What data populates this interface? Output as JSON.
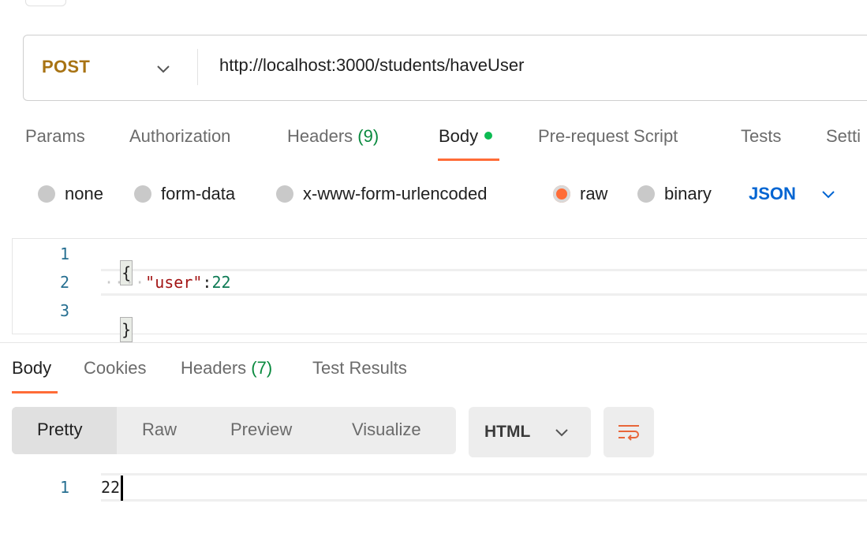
{
  "request": {
    "method": "POST",
    "url": "http://localhost:3000/students/haveUser",
    "tabs": [
      {
        "label": "Params",
        "count": ""
      },
      {
        "label": "Authorization",
        "count": ""
      },
      {
        "label": "Headers",
        "count": "(9)"
      },
      {
        "label": "Body",
        "count": ""
      },
      {
        "label": "Pre-request Script",
        "count": ""
      },
      {
        "label": "Tests",
        "count": ""
      },
      {
        "label": "Setti",
        "count": ""
      }
    ],
    "active_tab": "Body",
    "body_types": [
      "none",
      "form-data",
      "x-www-form-urlencoded",
      "raw",
      "binary"
    ],
    "selected_body_type": "raw",
    "body_format": "JSON",
    "editor": {
      "line_numbers": [
        "1",
        "2",
        "3"
      ],
      "open_brace": "{",
      "indent": "····",
      "key": "\"user\"",
      "colon": ":",
      "value": "22",
      "close_brace": "}"
    }
  },
  "response": {
    "tabs": [
      {
        "label": "Body",
        "count": ""
      },
      {
        "label": "Cookies",
        "count": ""
      },
      {
        "label": "Headers",
        "count": "(7)"
      },
      {
        "label": "Test Results",
        "count": ""
      }
    ],
    "active_tab": "Body",
    "view_modes": [
      "Pretty",
      "Raw",
      "Preview",
      "Visualize"
    ],
    "active_view": "Pretty",
    "language": "HTML",
    "editor": {
      "line_numbers": [
        "1"
      ],
      "content": "22"
    }
  },
  "colors": {
    "accent": "#ff6c37",
    "method_post": "#a87313",
    "link_blue": "#0265d2",
    "count_green": "#0a8a3f",
    "dot_green": "#0cbb52"
  },
  "icons": [
    "chevron-down-icon",
    "wrap-lines-icon"
  ]
}
